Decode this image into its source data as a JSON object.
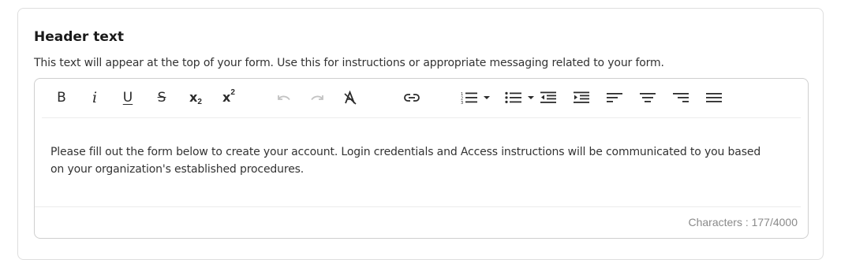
{
  "section": {
    "title": "Header text",
    "description": "This text will appear at the top of your form. Use this for instructions or appropriate messaging related to your form."
  },
  "toolbar": {
    "buttons": [
      {
        "name": "bold",
        "icon": "bold-icon"
      },
      {
        "name": "italic",
        "icon": "italic-icon"
      },
      {
        "name": "underline",
        "icon": "underline-icon"
      },
      {
        "name": "strikethrough",
        "icon": "strikethrough-icon"
      },
      {
        "name": "subscript",
        "icon": "subscript-icon"
      },
      {
        "name": "superscript",
        "icon": "superscript-icon"
      },
      {
        "name": "undo",
        "icon": "undo-icon",
        "state": "disabled"
      },
      {
        "name": "redo",
        "icon": "redo-icon",
        "state": "disabled"
      },
      {
        "name": "clear-formatting",
        "icon": "clear-format-icon"
      },
      {
        "name": "link",
        "icon": "link-icon"
      },
      {
        "name": "numbered-list",
        "icon": "ordered-list-icon",
        "dropdown": true
      },
      {
        "name": "bulleted-list",
        "icon": "bullet-list-icon",
        "dropdown": true
      },
      {
        "name": "outdent",
        "icon": "outdent-icon"
      },
      {
        "name": "indent",
        "icon": "indent-icon"
      },
      {
        "name": "align-left",
        "icon": "align-left-icon"
      },
      {
        "name": "align-center",
        "icon": "align-center-icon"
      },
      {
        "name": "align-right",
        "icon": "align-right-icon"
      },
      {
        "name": "justify",
        "icon": "justify-icon"
      }
    ],
    "labels": {
      "bold": "B",
      "italic": "i",
      "underline": "U",
      "strike": "S",
      "sub_base": "x",
      "sub_mark": "2",
      "sup_base": "x",
      "sup_mark": "2"
    }
  },
  "editor": {
    "content": "Please fill out the form below to create your account. Login credentials and Access instructions will be communicated to you based on your organization's established procedures.",
    "char_count": "Characters : 177/4000"
  },
  "colors": {
    "border": "#cfcfcf",
    "icon": "#2b2b2b",
    "icon_disabled": "#c3c3c3",
    "muted_text": "#8a8a8a"
  }
}
